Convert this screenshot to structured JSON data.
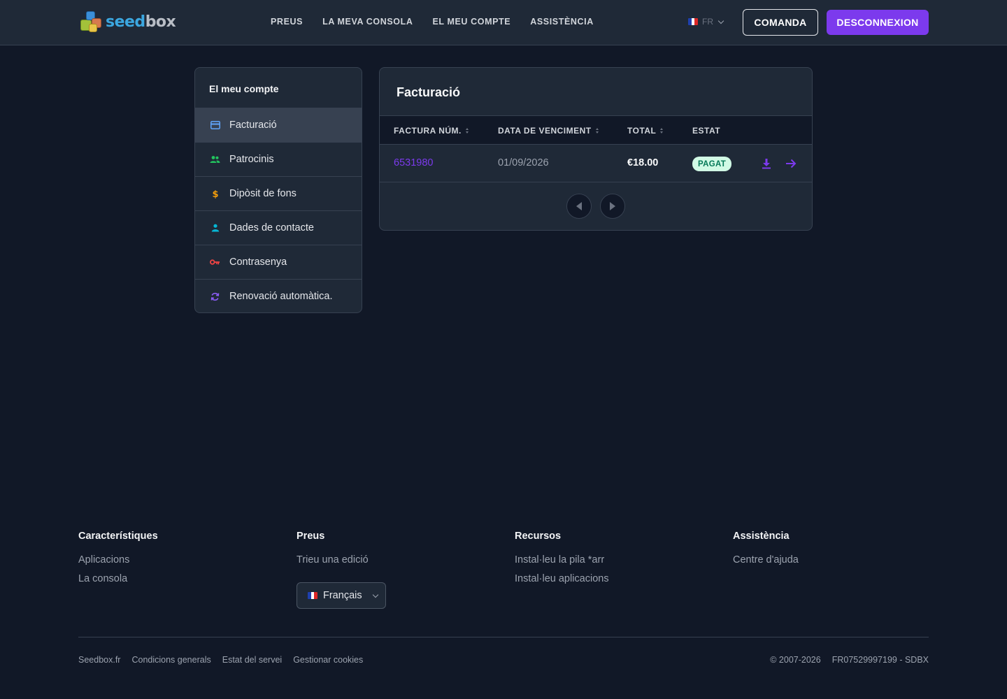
{
  "header": {
    "logo": {
      "seed": "seed",
      "box": "box",
      "brand": "Seedbox"
    },
    "nav": [
      "PREUS",
      "LA MEVA CONSOLA",
      "EL MEU COMPTE",
      "ASSISTÈNCIA"
    ],
    "language": "FR",
    "order_label": "COMANDA",
    "logout_label": "DESCONNEXION"
  },
  "sidebar": {
    "title": "El meu compte",
    "items": [
      {
        "label": "Facturació",
        "icon": "credit-card-icon",
        "active": true,
        "color": "#60a5fa"
      },
      {
        "label": "Patrocinis",
        "icon": "users-icon",
        "active": false,
        "color": "#22c55e"
      },
      {
        "label": "Dipòsit de fons",
        "icon": "dollar-icon",
        "active": false,
        "color": "#f59e0b"
      },
      {
        "label": "Dades de contacte",
        "icon": "user-icon",
        "active": false,
        "color": "#06b6d4"
      },
      {
        "label": "Contrasenya",
        "icon": "key-icon",
        "active": false,
        "color": "#ef4444"
      },
      {
        "label": "Renovació automàtica.",
        "icon": "refresh-icon",
        "active": false,
        "color": "#8b5cf6"
      }
    ]
  },
  "billing": {
    "title": "Facturació",
    "columns": [
      "FACTURA NÚM.",
      "DATA DE VENCIMENT",
      "TOTAL",
      "ESTAT"
    ],
    "rows": [
      {
        "invoice": "6531980",
        "due_date": "01/09/2026",
        "total": "€18.00",
        "status": "PAGAT"
      }
    ]
  },
  "footer": {
    "columns": [
      {
        "title": "Característiques",
        "links": [
          "Aplicacions",
          "La consola"
        ]
      },
      {
        "title": "Preus",
        "links": [
          "Trieu una edició"
        ]
      },
      {
        "title": "Recursos",
        "links": [
          "Instal·leu la pila *arr",
          "Instal·leu aplicacions"
        ]
      },
      {
        "title": "Assistència",
        "links": [
          "Centre d'ajuda"
        ]
      }
    ],
    "language_select": "Français",
    "bottom_links": [
      "Seedbox.fr",
      "Condicions generals",
      "Estat del servei",
      "Gestionar cookies"
    ],
    "copyright": "© 2007-2026",
    "company_id": "FR07529997199 - SDBX"
  },
  "colors": {
    "accent": "#7c3aed",
    "background": "#111827",
    "surface": "#1f2937",
    "paid_badge_bg": "#d1fae5",
    "paid_badge_text": "#047857"
  }
}
